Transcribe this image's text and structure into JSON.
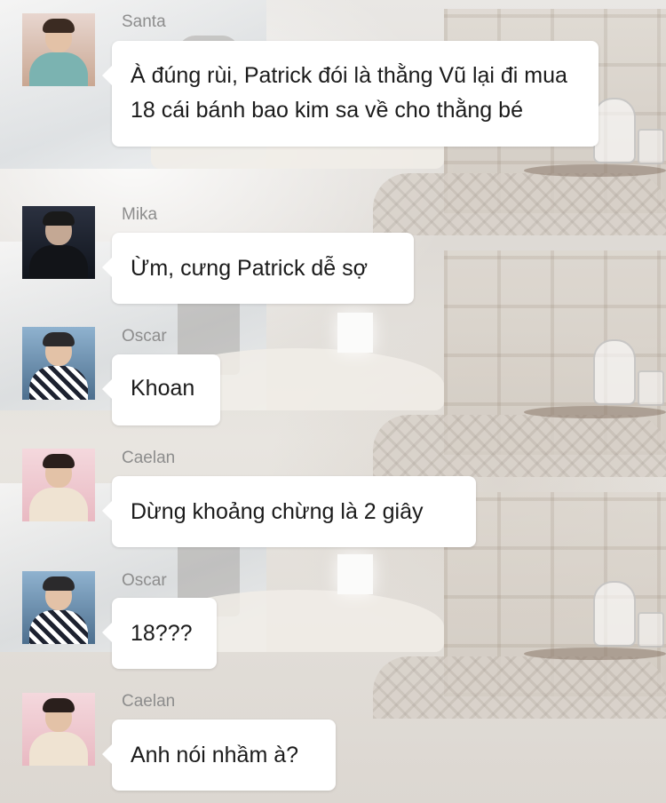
{
  "messages": [
    {
      "sender": "Santa",
      "avatar": "santa-avatar",
      "text": "À đúng rùi, Patrick đói là thằng Vũ lại đi mua 18 cái bánh bao kim sa về cho thằng bé"
    },
    {
      "sender": "Mika",
      "avatar": "mika-avatar",
      "text": "Ừm, cưng Patrick dễ sợ"
    },
    {
      "sender": "Oscar",
      "avatar": "oscar-avatar",
      "text": "Khoan"
    },
    {
      "sender": "Caelan",
      "avatar": "caelan-avatar",
      "text": "Dừng khoảng chừng là 2 giây"
    },
    {
      "sender": "Oscar",
      "avatar": "oscar-avatar",
      "text": "18???"
    },
    {
      "sender": "Caelan",
      "avatar": "caelan-avatar",
      "text": "Anh nói nhầm à?"
    }
  ],
  "colors": {
    "bubble": "#ffffff",
    "text": "#1b1b1b",
    "sender_name": "#8d8d8d"
  }
}
